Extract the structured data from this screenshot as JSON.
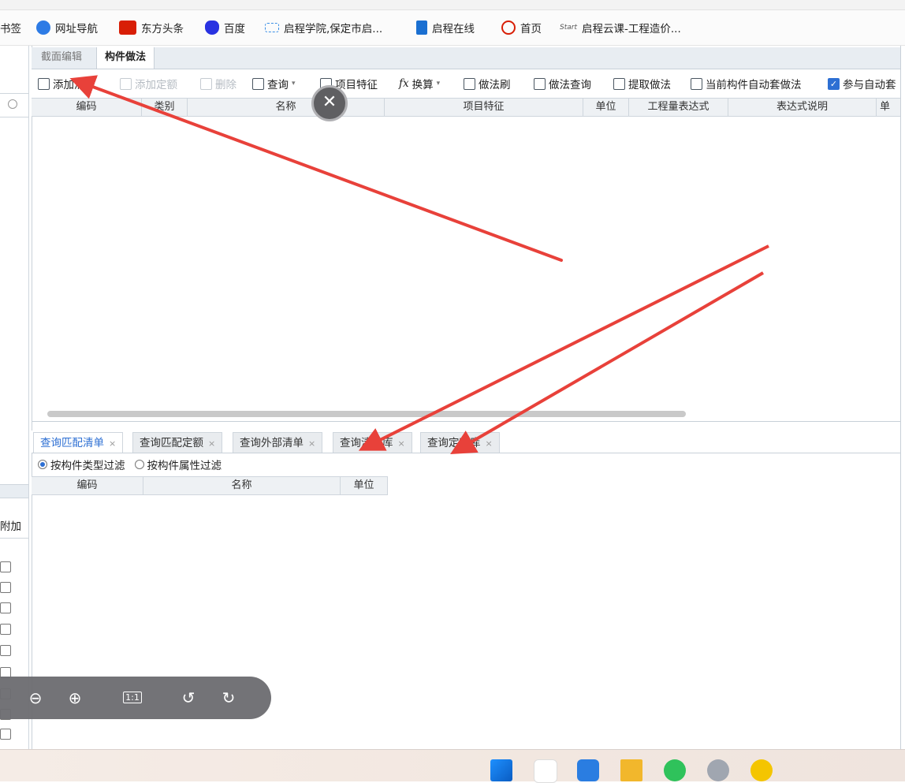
{
  "bookmarks": [
    {
      "label": "书签",
      "icon": "none",
      "color": ""
    },
    {
      "label": "网址导航",
      "icon": "compass-icon",
      "color": "#2d7be5"
    },
    {
      "label": "东方头条",
      "icon": "dongfang-icon",
      "color": "#d81e06"
    },
    {
      "label": "百度",
      "icon": "baidu-paw-icon",
      "color": "#2932e1"
    },
    {
      "label": "启程学院,保定市启...",
      "icon": "qicheng-logo-icon",
      "color": "#3a8ee6"
    },
    {
      "label": "启程在线",
      "icon": "qicheng-online-icon",
      "color": "#1a6fd1"
    },
    {
      "label": "首页",
      "icon": "home-badge-icon",
      "color": "#d81e06"
    },
    {
      "label": "启程云课-工程造价...",
      "icon": "start-logo-icon",
      "color": "#555555"
    }
  ],
  "tabs": [
    {
      "label": "截面编辑",
      "active": false
    },
    {
      "label": "构件做法",
      "active": true
    }
  ],
  "toolbar": [
    {
      "label": "添加清单",
      "enabled": true,
      "icon": "add-list-icon"
    },
    {
      "label": "添加定额",
      "enabled": false,
      "icon": "add-quota-icon"
    },
    {
      "label": "删除",
      "enabled": false,
      "icon": "delete-icon"
    },
    {
      "label": "查询",
      "enabled": true,
      "icon": "query-icon"
    },
    {
      "label": "项目特征",
      "enabled": true,
      "icon": "feature-icon"
    },
    {
      "label": "换算",
      "enabled": true,
      "icon": "fx-icon"
    },
    {
      "label": "做法刷",
      "enabled": true,
      "icon": "brush-icon"
    },
    {
      "label": "做法查询",
      "enabled": true,
      "icon": "method-query-icon"
    },
    {
      "label": "提取做法",
      "enabled": true,
      "icon": "extract-icon"
    },
    {
      "label": "当前构件自动套做法",
      "enabled": true,
      "icon": "auto-apply-icon"
    },
    {
      "label": "参与自动套",
      "enabled": true,
      "icon": "checkbox-checked-icon"
    }
  ],
  "upper_table": {
    "columns": [
      "编码",
      "类别",
      "名称",
      "项目特征",
      "单位",
      "工程量表达式",
      "表达式说明",
      "单"
    ]
  },
  "bottom_tabs": [
    {
      "label": "查询匹配清单",
      "active": true
    },
    {
      "label": "查询匹配定额",
      "active": false
    },
    {
      "label": "查询外部清单",
      "active": false
    },
    {
      "label": "查询清单库",
      "active": false
    },
    {
      "label": "查询定额库",
      "active": false
    }
  ],
  "filters": [
    {
      "label": "按构件类型过滤",
      "selected": true
    },
    {
      "label": "按构件属性过滤",
      "selected": false
    }
  ],
  "lower_table": {
    "columns": [
      "编码",
      "名称",
      "单位"
    ]
  },
  "left_panel": {
    "header_label": "附加"
  },
  "viewer": {
    "zoom_out": "zoom-out-icon",
    "zoom_in": "zoom-in-icon",
    "actual_size": "1:1",
    "rotate_left": "rotate-left-icon",
    "rotate_right": "rotate-right-icon"
  },
  "accent_colors": {
    "arrow": "#e8413a",
    "selected_tab": "#2d6fd3"
  }
}
